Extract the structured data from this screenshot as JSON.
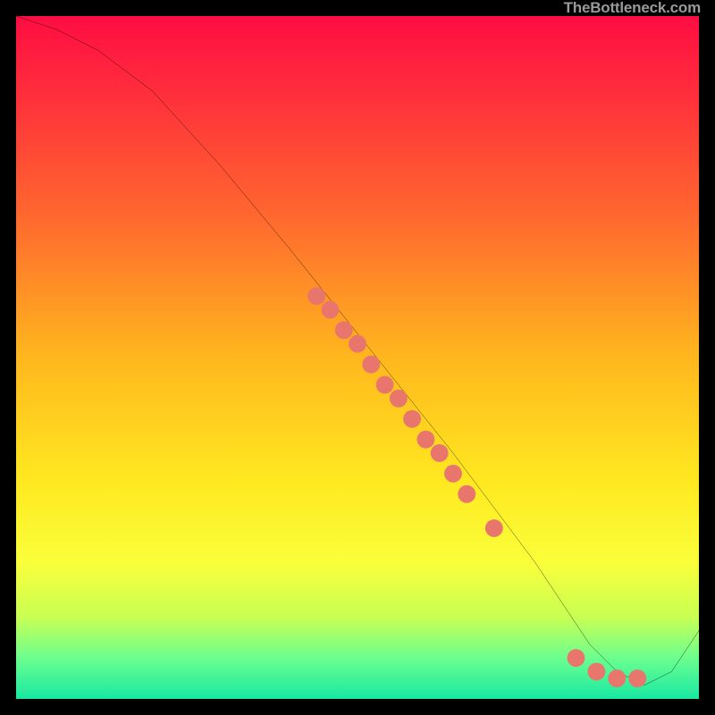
{
  "watermark": "TheBottleneck.com",
  "chart_data": {
    "type": "line",
    "title": "",
    "xlabel": "",
    "ylabel": "",
    "xlim": [
      0,
      100
    ],
    "ylim": [
      0,
      100
    ],
    "series": [
      {
        "name": "bottleneck-curve",
        "x": [
          0,
          6,
          12,
          20,
          30,
          40,
          48,
          56,
          64,
          70,
          76,
          80,
          84,
          88,
          92,
          96,
          100
        ],
        "y": [
          100,
          98,
          95,
          89,
          78,
          66,
          56,
          46,
          36,
          28,
          20,
          14,
          8,
          4,
          2,
          4,
          10
        ]
      }
    ],
    "scatter": {
      "name": "marker-dots",
      "color": "#e9766d",
      "points": [
        {
          "x": 44,
          "y": 59
        },
        {
          "x": 46,
          "y": 57
        },
        {
          "x": 48,
          "y": 54
        },
        {
          "x": 50,
          "y": 52
        },
        {
          "x": 52,
          "y": 49
        },
        {
          "x": 54,
          "y": 46
        },
        {
          "x": 56,
          "y": 44
        },
        {
          "x": 58,
          "y": 41
        },
        {
          "x": 60,
          "y": 38
        },
        {
          "x": 62,
          "y": 36
        },
        {
          "x": 64,
          "y": 33
        },
        {
          "x": 66,
          "y": 30
        },
        {
          "x": 70,
          "y": 25
        },
        {
          "x": 82,
          "y": 6
        },
        {
          "x": 85,
          "y": 4
        },
        {
          "x": 88,
          "y": 3
        },
        {
          "x": 91,
          "y": 3
        }
      ]
    }
  }
}
